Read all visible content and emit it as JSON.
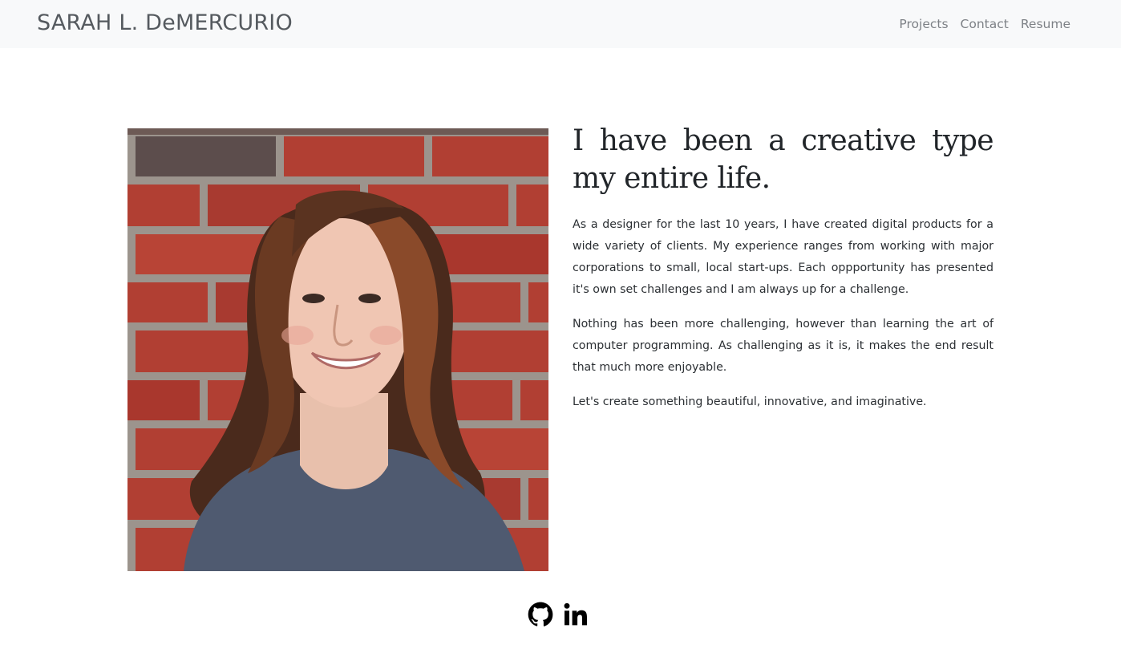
{
  "navbar": {
    "brand": "SARAH L. DeMERCURIO",
    "links": [
      {
        "label": "Projects"
      },
      {
        "label": "Contact"
      },
      {
        "label": "Resume"
      }
    ]
  },
  "about": {
    "photo_icon": "portrait-photo",
    "headline": "I have been a creative type my entire life.",
    "paragraphs": [
      "As a designer for the last 10 years, I have created digital products for a wide variety of clients. My experience ranges from working with major corporations to small, local start-ups. Each oppportunity has presented it's own set challenges and I am always up for a challenge.",
      "Nothing has been more challenging, however than learning the art of computer programming. As challenging as it is, it makes the end result that much more enjoyable.",
      "Let's create something beautiful, innovative, and imaginative."
    ]
  },
  "social": {
    "icons": [
      "github-icon",
      "linkedin-icon"
    ]
  },
  "colors": {
    "navbar_bg": "#f8f9fa",
    "brand": "#555a5f",
    "nav_link": "#7d8186",
    "text": "#212529"
  }
}
